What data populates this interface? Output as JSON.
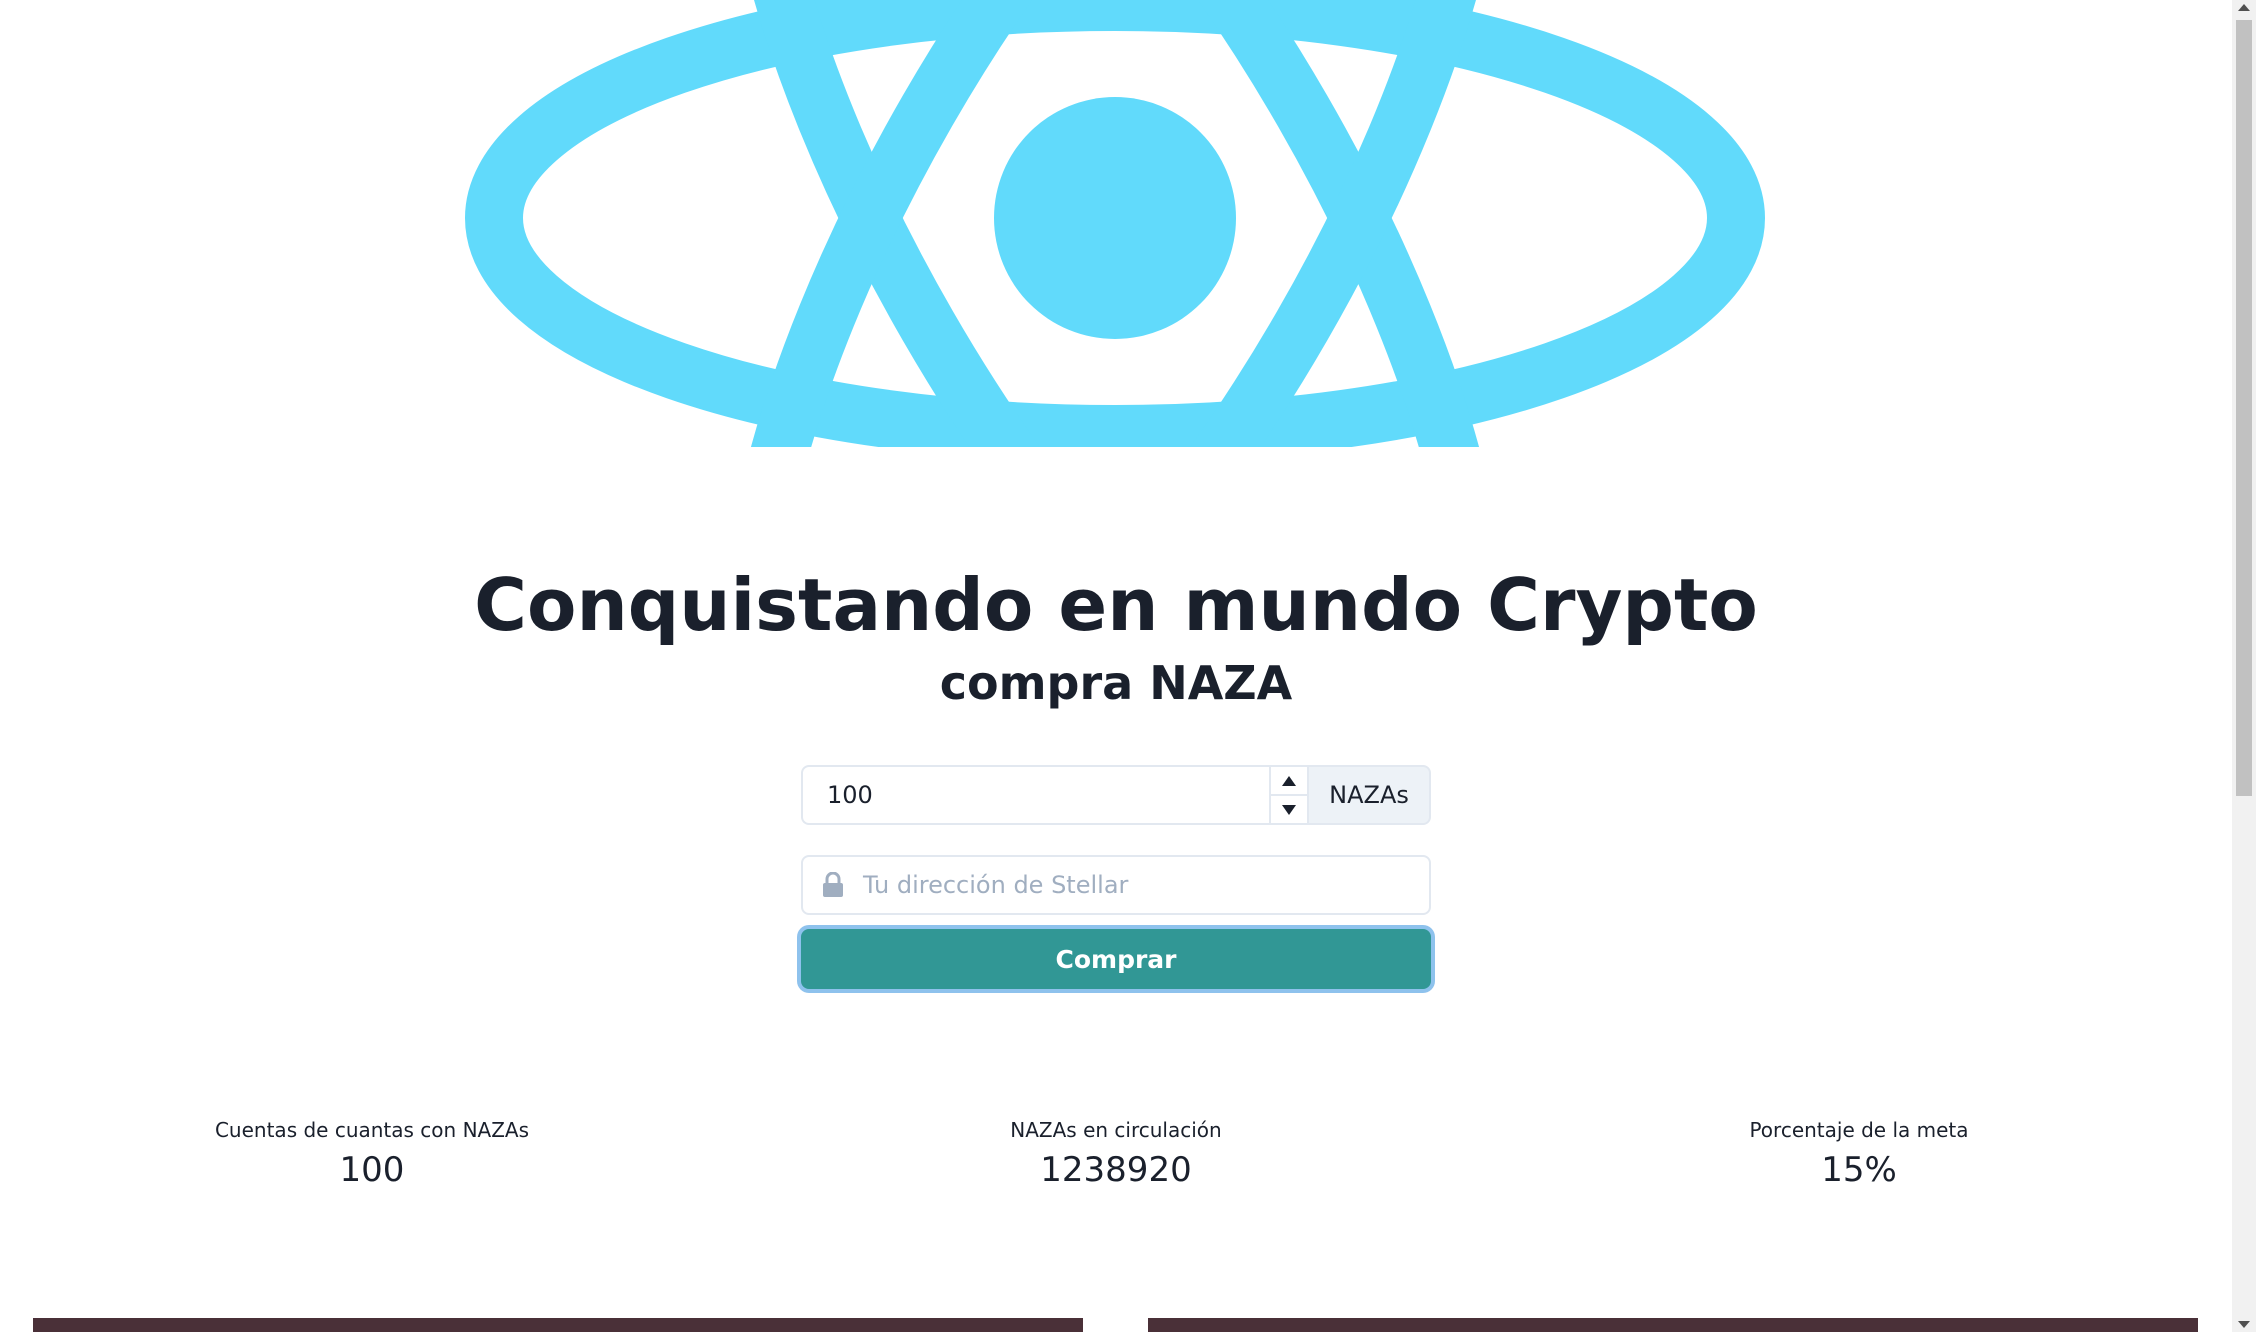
{
  "logo": {
    "icon": "react-atom-eye-logo",
    "color": "#61dafb"
  },
  "hero": {
    "title": "Conquistando en mundo Crypto",
    "subtitle": "compra NAZA"
  },
  "form": {
    "amount_value": "100",
    "amount_unit": "NAZAs",
    "address_placeholder": "Tu dirección de Stellar",
    "address_icon": "lock-icon",
    "buy_label": "Comprar",
    "buy_color": "#319795"
  },
  "stats": [
    {
      "label": "Cuentas de cuantas con NAZAs",
      "value": "100"
    },
    {
      "label": "NAZAs en circulación",
      "value": "1238920"
    },
    {
      "label": "Porcentaje de la meta",
      "value": "15%"
    }
  ]
}
